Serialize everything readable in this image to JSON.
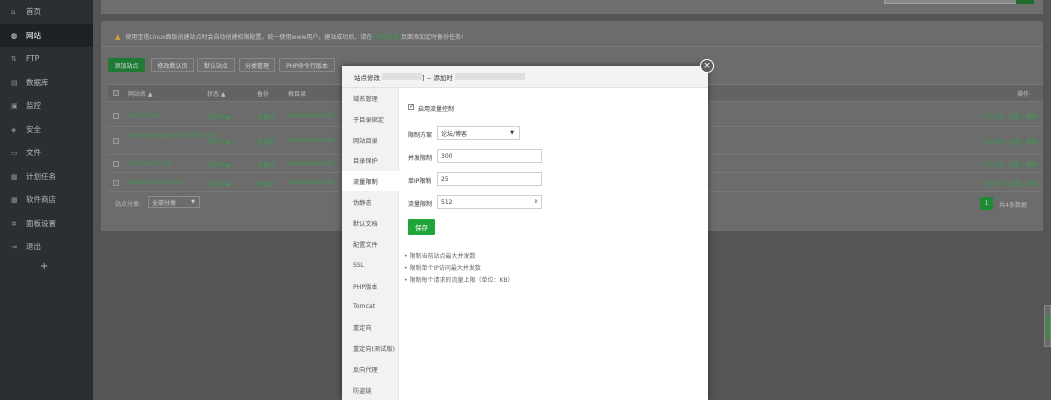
{
  "sidebar": {
    "items": [
      {
        "label": "首页",
        "icon": "home-icon",
        "glyph": "⌂"
      },
      {
        "label": "网站",
        "icon": "globe-icon",
        "glyph": "◍"
      },
      {
        "label": "FTP",
        "icon": "ftp-icon",
        "glyph": "⇅"
      },
      {
        "label": "数据库",
        "icon": "database-icon",
        "glyph": "▤"
      },
      {
        "label": "监控",
        "icon": "monitor-icon",
        "glyph": "▣"
      },
      {
        "label": "安全",
        "icon": "shield-icon",
        "glyph": "◈"
      },
      {
        "label": "文件",
        "icon": "folder-icon",
        "glyph": "▭"
      },
      {
        "label": "计划任务",
        "icon": "calendar-icon",
        "glyph": "▦"
      },
      {
        "label": "软件商店",
        "icon": "store-icon",
        "glyph": "▩"
      },
      {
        "label": "面板设置",
        "icon": "gear-icon",
        "glyph": "✲"
      },
      {
        "label": "退出",
        "icon": "logout-icon",
        "glyph": "⇥"
      }
    ],
    "add_glyph": "+"
  },
  "alert": {
    "icon_glyph": "▲",
    "text": "使用宝塔Linux面板创建站点时会自动创建权限配置，统一使用www用户。建站成功后，请在",
    "link": "[计划任务]",
    "text_after": "页面添加定时备份任务!"
  },
  "toolbar": {
    "add_site": "添加站点",
    "default_page": "修改默认页",
    "default_site": "默认站点",
    "category": "分类管理",
    "php_cli": "PHP命令行版本"
  },
  "table": {
    "headers": {
      "name": "网站名 ▲",
      "status": "状态 ▲",
      "backup": "备份",
      "root": "根目录",
      "ops": "操作"
    },
    "rows": [
      {
        "name": "mznzd.com",
        "status": "运行中 ▶",
        "backup": "无备份",
        "root": "/www/wwwroot/",
        "ops": "防火墙 | 设置 | 删除"
      },
      {
        "name": "wuyinghang.yaohulu168.com",
        "status": "运行中 ▶",
        "backup": "无备份",
        "root": "/www/wwwroot/",
        "ops": "防火墙 | 设置 | 删除"
      },
      {
        "name": "cd.mznzd.com",
        "status": "运行中 ▶",
        "backup": "无备份",
        "root": "/www/wwwroot/",
        "ops": "防火墙 | 设置 | 删除"
      },
      {
        "name": "kaixin.mznzd.com",
        "status": "运行中 ▶",
        "backup": "有备份",
        "root": "/www/wwwroot/",
        "ops": "防火墙 | 设置 | 删除"
      }
    ]
  },
  "footer": {
    "cat_label": "站点分类:",
    "cat_value": "全部分类",
    "cat_arrow": "▼",
    "page": "1",
    "total": "共4条数据"
  },
  "modal": {
    "title_prefix": "站点修改",
    "title_mid": "] -- 添加时",
    "close_glyph": "×",
    "tabs": [
      "域名管理",
      "子目录绑定",
      "网站目录",
      "目录保护",
      "流量限制",
      "伪静态",
      "默认文档",
      "配置文件",
      "SSL",
      "PHP版本",
      "Tomcat",
      "重定向",
      "重定向(测试版)",
      "反向代理",
      "防盗链"
    ],
    "active_tab": 4,
    "form": {
      "enable_label": "启用流量控制",
      "enable_checked": true,
      "plan_label": "限制方案",
      "plan_value": "论坛/博客",
      "plan_arrow": "▼",
      "concurrent_label": "并发限制",
      "concurrent_value": "300",
      "per_ip_label": "单IP限制",
      "per_ip_value": "25",
      "rate_label": "流量限制",
      "rate_value": "512",
      "save": "保存"
    },
    "notes": [
      "限制当前站点最大并发数",
      "限制单个IP访问最大并发数",
      "限制每个请求的流量上限（单位：KB）"
    ]
  },
  "colors": {
    "accent": "#20a53a",
    "sidebar": "#2b2f33"
  }
}
